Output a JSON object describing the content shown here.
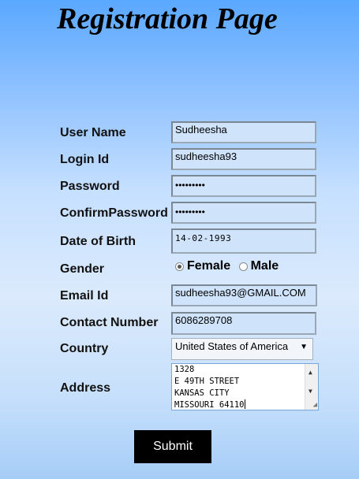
{
  "title": "Registration Page",
  "form": {
    "username": {
      "label": "User Name",
      "value": "Sudheesha"
    },
    "login_id": {
      "label": "Login Id",
      "value": "sudheesha93"
    },
    "password": {
      "label": "Password",
      "value": "•••••••••"
    },
    "confirm_password": {
      "label": "ConfirmPassword",
      "value": "•••••••••"
    },
    "dob": {
      "label": "Date of Birth",
      "value": "14-02-1993"
    },
    "gender": {
      "label": "Gender",
      "options": [
        "Female",
        "Male"
      ],
      "selected": "Female"
    },
    "email": {
      "label": "Email Id",
      "value": "sudheesha93@GMAIL.COM"
    },
    "contact": {
      "label": "Contact Number",
      "value": "6086289708"
    },
    "country": {
      "label": "Country",
      "value": "United States of America"
    },
    "address": {
      "label": "Address",
      "lines": [
        "1328",
        "E 49TH STREET",
        "KANSAS CITY",
        "MISSOURI 64110"
      ]
    },
    "submit_label": "Submit"
  }
}
